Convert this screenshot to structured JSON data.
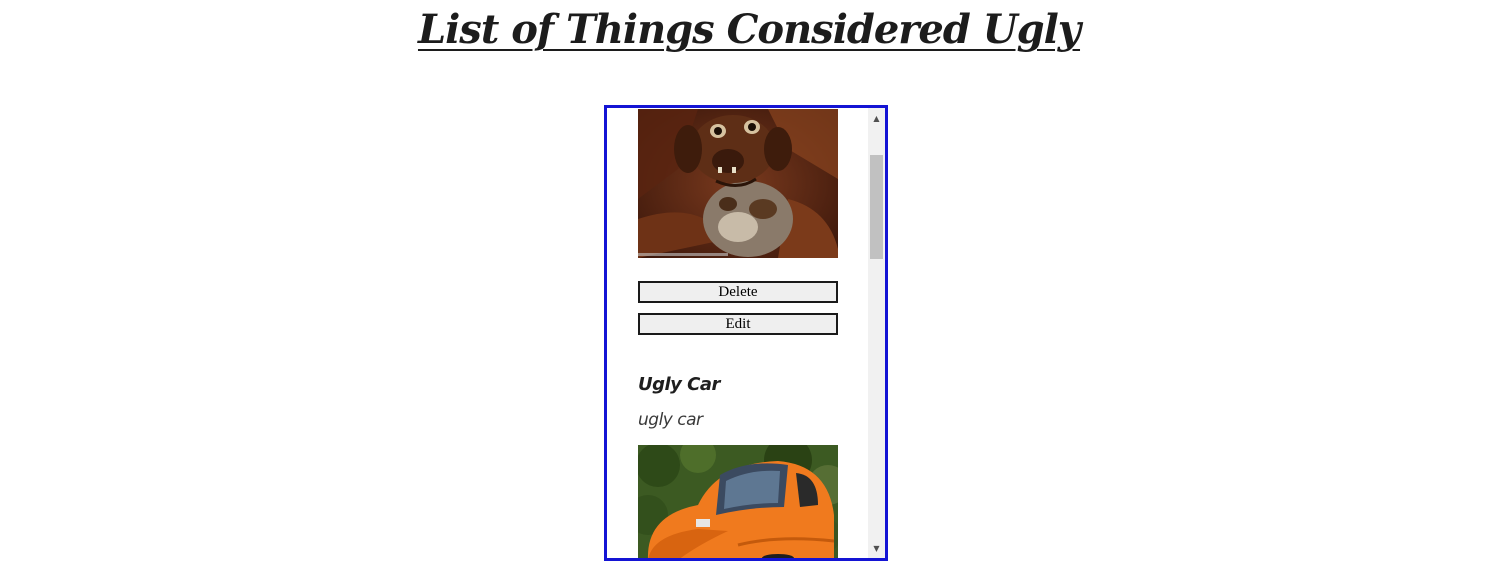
{
  "page": {
    "title": "List of Things Considered Ugly"
  },
  "items": [
    {
      "image_icon": "ugly-dog-photo",
      "delete_label": "Delete",
      "edit_label": "Edit"
    },
    {
      "title": "Ugly Car",
      "description": "ugly car",
      "image_icon": "orange-bubble-car-photo"
    }
  ],
  "scrollbar": {
    "up_icon": "▲",
    "down_icon": "▼",
    "position_fraction": 0.1
  },
  "colors": {
    "frame_border": "#1414d4",
    "button_background": "#efefef",
    "car_orange": "#f07a1e"
  }
}
